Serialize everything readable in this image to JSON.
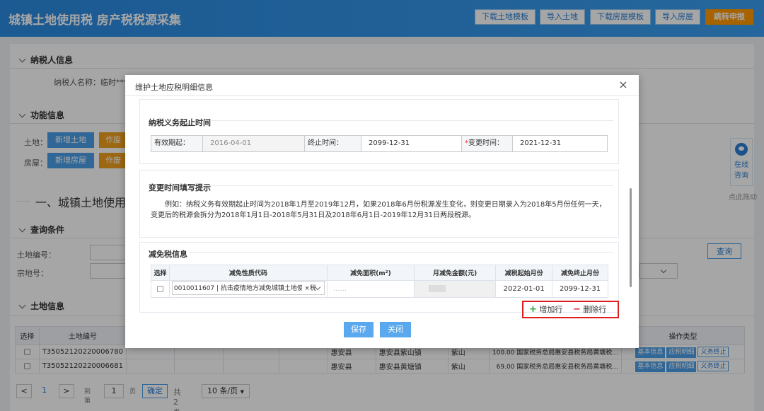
{
  "header": {
    "title": "城镇土地使用税 房产税税源采集",
    "buttons": [
      "下载土地模板",
      "导入土地",
      "下载房屋模板",
      "导入房屋",
      "跳转申报"
    ]
  },
  "taxpayer": {
    "section": "纳税人信息",
    "name_label": "纳税人名称：临时****"
  },
  "function": {
    "section": "功能信息",
    "land_label": "土地：",
    "house_label": "房屋：",
    "add_land": "新增土地",
    "add_house": "新增房屋",
    "void_short": "作废"
  },
  "main_heading": "一、城镇土地使用税",
  "query": {
    "section": "查询条件",
    "land_no_label": "土地编号：",
    "parcel_no_label": "宗地号：",
    "query_btn": "查询"
  },
  "land_info": {
    "section": "土地信息",
    "headers": [
      "选择",
      "土地编号",
      "操作类型"
    ],
    "rows": [
      {
        "id": "T35052120220006780",
        "county": "惠安县",
        "town": "惠安县紫山镇",
        "village": "紫山",
        "amount": "100.00",
        "org": "国家税务总局惠安县税务局黄塘税..."
      },
      {
        "id": "T35052120220006681",
        "county": "惠安县",
        "town": "惠安县黄塘镇",
        "village": "紫山",
        "amount": "69.00",
        "org": "国家税务总局惠安县税务局黄塘税..."
      }
    ],
    "ops": [
      "基本信息",
      "应税明细",
      "义务终止"
    ]
  },
  "pager": {
    "prev": "<",
    "page": "1",
    "next": ">",
    "goto": "到第",
    "input": "1",
    "page_unit": "页",
    "confirm": "确定",
    "total": "共2条",
    "size": "10 条/页"
  },
  "side": {
    "online_1": "在线",
    "online_2": "咨询",
    "drag": "点此拖动"
  },
  "modal": {
    "title": "维护土地应税明细信息",
    "close": "×",
    "period": {
      "title": "纳税义务起止时间",
      "start_label": "有效期起：",
      "start_value": "2016-04-01",
      "end_label": "终止时间：",
      "end_value": "2099-12-31",
      "change_req": "*",
      "change_label": "变更时间：",
      "change_value": "2021-12-31"
    },
    "hint": {
      "title": "变更时间填写提示",
      "text_1": "例如：纳税义务有效期起止时间为2018年1月至2019年12月，如果2018年6月份税源发生变化，则变更日期录入为2018年5月份任何一天，",
      "text_2": "变更后的税源会拆分为2018年1月1日-2018年5月31日及2018年6月1日-2019年12月31日两段税源。"
    },
    "relief": {
      "title": "减免税信息",
      "headers": [
        "选择",
        "减免性质代码",
        "减免面积(m²)",
        "月减免金额(元)",
        "减税起始月份",
        "减免终止月份"
      ],
      "row": {
        "code": "0010011607 | 抗击疫情地方减免城镇土地使用税",
        "area_placeholder": "......",
        "start": "2022-01-01",
        "end": "2099-12-31"
      },
      "add_row": "增加行",
      "del_row": "删除行"
    },
    "save": "保存",
    "close_btn": "关闭"
  }
}
